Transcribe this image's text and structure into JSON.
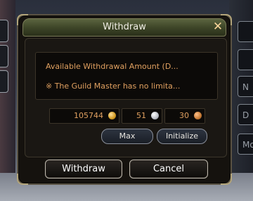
{
  "window": {
    "title": "Withdraw",
    "close_icon": "close-icon"
  },
  "info": {
    "line1": "Available Withdrawal Amount (D...",
    "line2": "※ The Guild Master has no limita..."
  },
  "amounts": {
    "gold": "105744",
    "silver": "51",
    "copper": "30"
  },
  "buttons": {
    "max": "Max",
    "initialize": "Initialize",
    "withdraw": "Withdraw",
    "cancel": "Cancel"
  },
  "background": {
    "right_tabs": [
      "",
      "",
      "",
      "N",
      "D",
      "Mo"
    ]
  },
  "colors": {
    "info_text": "#e0a060",
    "title_bar": "#3e4628",
    "gold_coin": "#d19a22",
    "silver_coin": "#b8bcc4",
    "copper_coin": "#c57a35"
  }
}
